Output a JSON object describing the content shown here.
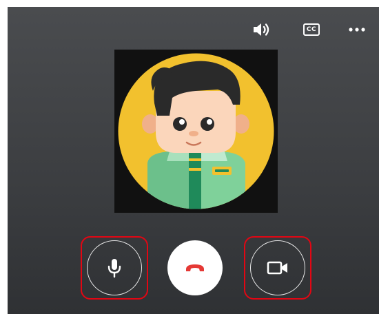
{
  "top_bar": {
    "volume_icon": "volume-icon",
    "cc_label": "CC",
    "more_icon": "more-options-icon"
  },
  "video": {
    "avatar_icon": "avatar-boy-illustration"
  },
  "controls": {
    "mic_icon": "microphone-icon",
    "hangup_icon": "phone-hangup-icon",
    "camera_icon": "video-camera-icon",
    "highlight_color": "#e30613",
    "hangup_color": "#e53935"
  },
  "colors": {
    "background_top": "#4a4c4f",
    "background_bottom": "#2f3134",
    "avatar_circle": "#f2c12e",
    "shirt_green": "#6cc08b",
    "hair": "#2a2a2a"
  }
}
